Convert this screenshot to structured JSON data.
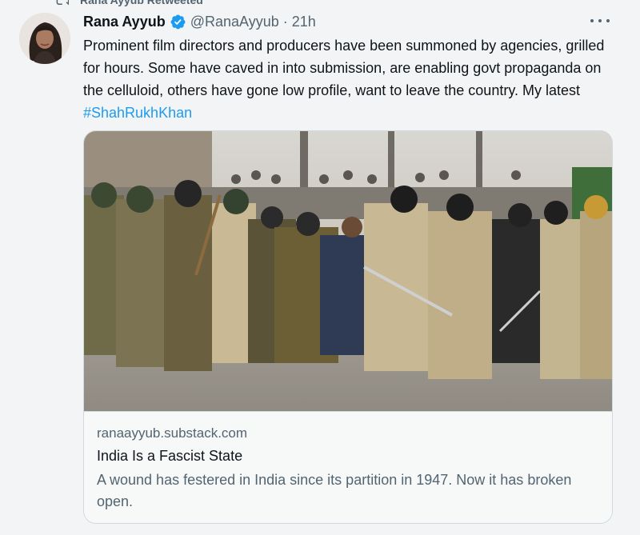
{
  "retweet": {
    "label": "Rana Ayyub Retweeted"
  },
  "tweet": {
    "author_name": "Rana Ayyub",
    "handle": "@RanaAyyub",
    "separator": "·",
    "time": "21h",
    "text": "Prominent film directors and producers have been summoned by agencies, grilled for hours.  Some have caved in into submission, are enabling govt propaganda on the celluloid, others have gone low profile, want to leave the country. My latest ",
    "hashtag": "#ShahRukhKhan"
  },
  "card": {
    "domain": "ranaayyub.substack.com",
    "title": "India Is a Fascist State",
    "description": "A wound has festered in India since its partition in 1947. Now it has broken open."
  },
  "colors": {
    "link": "#1d9bf0",
    "verified": "#1d9bf0",
    "secondary_text": "#536471",
    "primary_text": "#0f1419"
  },
  "icons": [
    "retweet-icon",
    "verified-badge-icon",
    "more-options-icon"
  ]
}
